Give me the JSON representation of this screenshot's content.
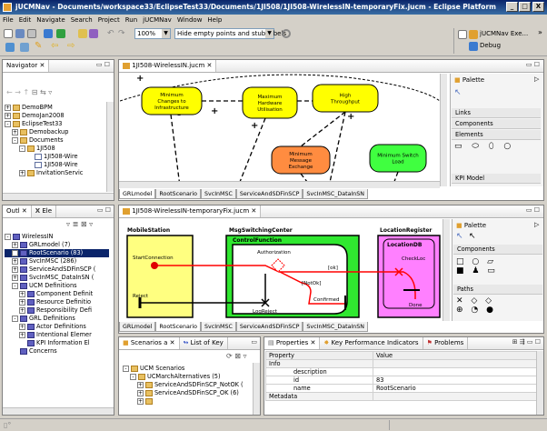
{
  "window": {
    "title": "jUCMNav - Documents/workspace33/EclipseTest33/Documents/1JI508/1JI508-WirelessIN-temporaryFix.jucm - Eclipse Platform",
    "min": "_",
    "max": "□",
    "close": "X"
  },
  "menu": [
    "File",
    "Edit",
    "Navigate",
    "Search",
    "Project",
    "Run",
    "jUCMNav",
    "Window",
    "Help"
  ],
  "toolbar": {
    "zoom": "100%",
    "filter": "Hide empty points and stub labels",
    "persp1": "jUCMNav Exe...",
    "persp2": "Debug",
    "more": "»"
  },
  "navigator": {
    "tab": "Navigator",
    "items": [
      {
        "label": "DemoBPM",
        "indent": 0,
        "pm": "+",
        "icon": "fold"
      },
      {
        "label": "DemoJan2008",
        "indent": 0,
        "pm": "+",
        "icon": "fold"
      },
      {
        "label": "EclipseTest33",
        "indent": 0,
        "pm": "-",
        "icon": "fold"
      },
      {
        "label": "Demobackup",
        "indent": 1,
        "pm": "+",
        "icon": "fold"
      },
      {
        "label": "Documents",
        "indent": 1,
        "pm": "-",
        "icon": "fold"
      },
      {
        "label": "1JI508",
        "indent": 2,
        "pm": "-",
        "icon": "fold"
      },
      {
        "label": "1JI508-Wire",
        "indent": 3,
        "pm": "",
        "icon": "file"
      },
      {
        "label": "1JI508-Wire",
        "indent": 3,
        "pm": "",
        "icon": "file"
      },
      {
        "label": "InvitationServic",
        "indent": 2,
        "pm": "+",
        "icon": "fold"
      }
    ]
  },
  "outline": {
    "tabs": [
      "Outl",
      "Ele"
    ],
    "items": [
      {
        "label": "WirelessIN",
        "indent": 0,
        "pm": "-"
      },
      {
        "label": "GRLmodel (7)",
        "indent": 1,
        "pm": "+"
      },
      {
        "label": "RootScenario (83)",
        "indent": 1,
        "pm": "+",
        "selected": true
      },
      {
        "label": "SvcInMSC (286)",
        "indent": 1,
        "pm": "+"
      },
      {
        "label": "ServiceAndSDFinSCP (",
        "indent": 1,
        "pm": "+"
      },
      {
        "label": "SvcInMSC_DataInSN (",
        "indent": 1,
        "pm": "+"
      },
      {
        "label": "UCM Definitions",
        "indent": 1,
        "pm": "-"
      },
      {
        "label": "Component Definit",
        "indent": 2,
        "pm": "+"
      },
      {
        "label": "Resource Definitio",
        "indent": 2,
        "pm": "+"
      },
      {
        "label": "Responsibility Defi",
        "indent": 2,
        "pm": "+"
      },
      {
        "label": "GRL Definitions",
        "indent": 1,
        "pm": "-"
      },
      {
        "label": "Actor Definitions",
        "indent": 2,
        "pm": "+"
      },
      {
        "label": "Intentional Elemer",
        "indent": 2,
        "pm": "+"
      },
      {
        "label": "KPI Information El",
        "indent": 2,
        "pm": ""
      },
      {
        "label": "Concerns",
        "indent": 1,
        "pm": ""
      }
    ]
  },
  "editor1": {
    "tab": "1JI508-WirelessIN.jucm",
    "goals": [
      "Minimum Changes to Infrastructure",
      "Maximum Hardware Utilisation",
      "High Throughput",
      "Minimum Message Exchange",
      "Minimum Switch Load"
    ],
    "marks": [
      "+",
      "-",
      "+",
      "+"
    ],
    "tabs": [
      "GRLmodel",
      "RootScenario",
      "SvcInMSC",
      "ServiceAndSDFinSCP",
      "SvcInMSC_DataInSN"
    ]
  },
  "palette1": {
    "title": "Palette",
    "sections": [
      "Links",
      "Components",
      "Elements",
      "KPI Model"
    ]
  },
  "editor2": {
    "tab": "1JI508-WirelessIN-temporaryFix.jucm",
    "tabs": [
      "GRLmodel",
      "RootScenario",
      "SvcInMSC",
      "ServiceAndSDFinSCP",
      "SvcInMSC_DataInSN"
    ],
    "components": [
      "MobileStation",
      "MsgSwitchingCenter",
      "ControlFunction",
      "LocationRegister",
      "LocationDB"
    ],
    "labels": [
      "StartConnection",
      "Reject",
      "Authorization",
      "[ok]",
      "[NotOk]",
      "LogReject",
      "Confirmed",
      "CheckLoc",
      "Done"
    ]
  },
  "palette2": {
    "title": "Palette",
    "sections": [
      "Components",
      "Paths"
    ]
  },
  "scenarios": {
    "tabs": [
      "Scenarios a",
      "List of Key"
    ],
    "items": [
      {
        "label": "UCM Scenarios",
        "indent": 0,
        "pm": "-"
      },
      {
        "label": "UCMarchAlternatives (5)",
        "indent": 1,
        "pm": "-"
      },
      {
        "label": "ServiceAndSDFinSCP_NotOK (",
        "indent": 2,
        "pm": "+"
      },
      {
        "label": "ServiceAndSDFinSCP_OK (6)",
        "indent": 2,
        "pm": "+"
      },
      {
        "label": "",
        "indent": 2,
        "pm": "+"
      }
    ]
  },
  "props": {
    "tabs": [
      "Properties",
      "Key Performance Indicators",
      "Problems"
    ],
    "headers": [
      "Property",
      "Value"
    ],
    "rows": [
      {
        "p": "Info",
        "v": "",
        "group": true
      },
      {
        "p": "description",
        "v": ""
      },
      {
        "p": "id",
        "v": "83"
      },
      {
        "p": "name",
        "v": "RootScenario"
      },
      {
        "p": "Metadata",
        "v": "",
        "group": true
      }
    ]
  },
  "status": {
    "left": ""
  },
  "colors": {
    "goal": "#ffff00",
    "goalAlt": "#ff8c40",
    "goalGreen": "#40ff40",
    "mobile": "#ffff80",
    "msc": "#30e830",
    "ctrl": "#ffffff",
    "lr": "#ff80ff",
    "path": "#ff0000"
  }
}
